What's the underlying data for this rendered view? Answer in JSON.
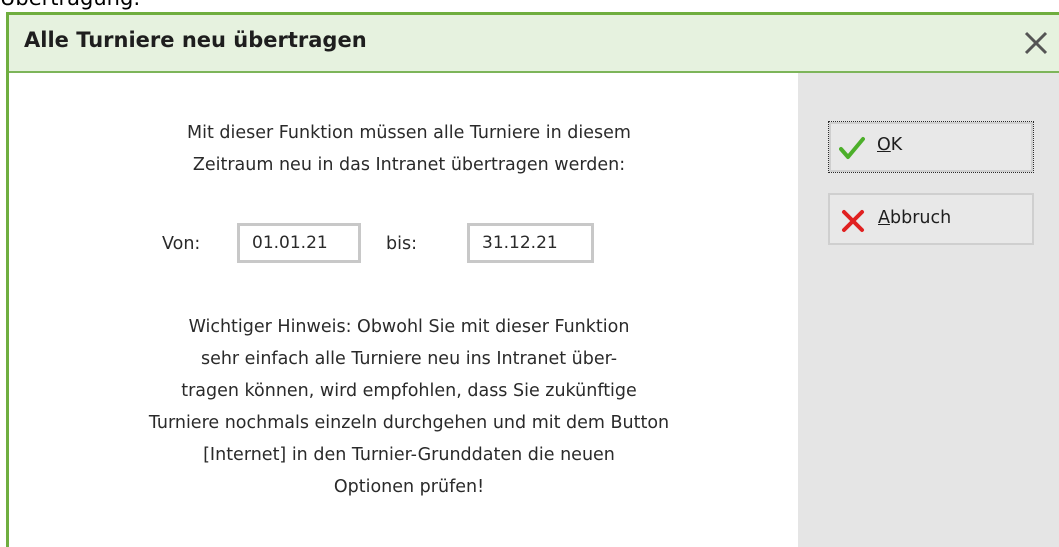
{
  "background": {
    "cut_text": "Übertragung:"
  },
  "dialog": {
    "title": "Alle Turniere neu übertragen",
    "close_icon": "close-icon",
    "intro_lines": [
      "Mit dieser Funktion müssen alle Turniere in diesem",
      "Zeitraum neu in das Intranet übertragen werden:"
    ],
    "from_label": "Von:",
    "from_value": "01.01.21",
    "to_label": "bis:",
    "to_value": "31.12.21",
    "note_lines": [
      "Wichtiger Hinweis: Obwohl Sie mit dieser Funktion",
      "sehr einfach alle Turniere neu ins Intranet über-",
      "tragen können, wird empfohlen, dass Sie zukünftige",
      "Turniere nochmals einzeln durchgehen und mit dem Button",
      "[Internet] in den Turnier-Grunddaten die neuen",
      "Optionen prüfen!"
    ],
    "ok_button": {
      "mnemonic": "O",
      "rest": "K",
      "icon": "checkmark-icon"
    },
    "cancel_button": {
      "mnemonic": "A",
      "rest": "bbruch",
      "icon": "cross-icon"
    }
  },
  "colors": {
    "accent_green": "#6fae3f",
    "titlebar_bg": "#e6f2df",
    "side_panel_bg": "#e5e5e5",
    "ok_icon": "#4caf2a",
    "cancel_icon": "#e02020"
  }
}
